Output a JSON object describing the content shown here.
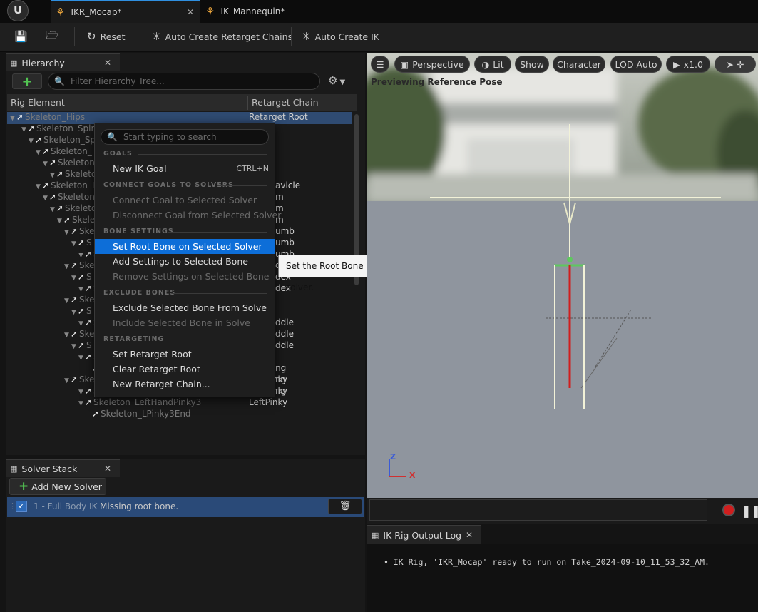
{
  "tabs": [
    {
      "label": "IKR_Mocap*",
      "icon": "person-icon",
      "active": true
    },
    {
      "label": "IK_Mannequin*",
      "icon": "person-icon",
      "active": false
    }
  ],
  "toolbar": {
    "reset_label": "Reset",
    "auto_chains_label": "Auto Create Retarget Chains",
    "auto_ik_label": "Auto Create IK"
  },
  "hierarchy": {
    "title": "Hierarchy",
    "filter_placeholder": "Filter Hierarchy Tree...",
    "col_rig_element": "Rig Element",
    "col_retarget_chain": "Retarget Chain",
    "rows": [
      {
        "name": "Skeleton_Hips"
      },
      {
        "name": "Skeleton_Spine"
      },
      {
        "name": "Skeleton_Sp"
      },
      {
        "name": "Skeleton_"
      },
      {
        "name": "Skeleton"
      },
      {
        "name": "Skeleto"
      },
      {
        "name": "Skeleton_L"
      },
      {
        "name": "Skeleton"
      },
      {
        "name": "Skeleto"
      },
      {
        "name": "Skelet"
      },
      {
        "name": "Ske"
      },
      {
        "name": "S"
      },
      {
        "name": "S"
      },
      {
        "name": "Ske"
      },
      {
        "name": "S"
      },
      {
        "name": "S"
      },
      {
        "name": "Ske"
      },
      {
        "name": "S"
      },
      {
        "name": "S"
      },
      {
        "name": "Ske"
      },
      {
        "name": "S"
      },
      {
        "name": "S"
      },
      {
        "name": "Skeleton_LRing3End"
      },
      {
        "name": "Skeleton_LeftHandPinky1"
      },
      {
        "name": "Skeleton_LeftHandPinky2"
      },
      {
        "name": "Skeleton_LeftHandPinky3"
      },
      {
        "name": "Skeleton_LPinky3End"
      }
    ],
    "chains": [
      {
        "row": 0,
        "label": "Retarget Root"
      },
      {
        "row": 6,
        "label": "avicle"
      },
      {
        "row": 7,
        "label": "m"
      },
      {
        "row": 8,
        "label": "m"
      },
      {
        "row": 9,
        "label": "m"
      },
      {
        "row": 10,
        "label": "umb"
      },
      {
        "row": 11,
        "label": "umb"
      },
      {
        "row": 12,
        "label": "umb"
      },
      {
        "row": 13,
        "label": "dex"
      },
      {
        "row": 14,
        "label": "dex"
      },
      {
        "row": 15,
        "label": "dex"
      },
      {
        "row": 18,
        "label": "ddle"
      },
      {
        "row": 19,
        "label": "ddle"
      },
      {
        "row": 20,
        "label": "ddle"
      },
      {
        "row": 22,
        "label": "ng"
      },
      {
        "row": 23,
        "label": "ng"
      },
      {
        "row": 24,
        "label": "ng"
      },
      {
        "row": 23,
        "label": "LeftPinky"
      },
      {
        "row": 24,
        "label": "LeftPinky"
      },
      {
        "row": 25,
        "label": "LeftPinky"
      }
    ]
  },
  "context_menu": {
    "search_placeholder": "Start typing to search",
    "sections": {
      "goals": "GOALS",
      "connect": "CONNECT GOALS TO SOLVERS",
      "bone_settings": "BONE SETTINGS",
      "exclude": "EXCLUDE BONES",
      "retargeting": "RETARGETING"
    },
    "items": {
      "new_ik_goal": "New IK Goal",
      "new_ik_goal_shortcut": "CTRL+N",
      "connect_goal": "Connect Goal to Selected Solver",
      "disconnect_goal": "Disconnect Goal from Selected Solver",
      "set_root_bone": "Set Root Bone on Selected Solver",
      "add_settings": "Add Settings to Selected Bone",
      "remove_settings": "Remove Settings on Selected Bone",
      "exclude_bone": "Exclude Selected Bone From Solve",
      "include_bone": "Include Selected Bone in Solve",
      "set_retarget_root": "Set Retarget Root",
      "clear_retarget_root": "Clear Retarget Root",
      "new_retarget_chain": "New Retarget Chain..."
    },
    "tooltip": "Set the Root Bone setting on the selected solver."
  },
  "viewport": {
    "perspective_label": "Perspective",
    "lit_label": "Lit",
    "show_label": "Show",
    "character_label": "Character",
    "lod_label": "LOD Auto",
    "speed_label": "x1.0",
    "preview_label": "Previewing Reference Pose",
    "axis_z": "Z",
    "axis_x": "X"
  },
  "solver_stack": {
    "title": "Solver Stack",
    "add_label": "Add New Solver",
    "solver_name": "1 - Full Body IK",
    "solver_warning": "Missing root bone."
  },
  "output_log": {
    "title": "IK Rig Output Log",
    "message": "IK Rig, 'IKR_Mocap' ready to run on Take_2024-09-10_11_53_32_AM."
  },
  "colors": {
    "accent": "#0d6ed8",
    "selected_row": "#2a4a78",
    "add_green": "#52c452",
    "record_red": "#d01e1e"
  }
}
